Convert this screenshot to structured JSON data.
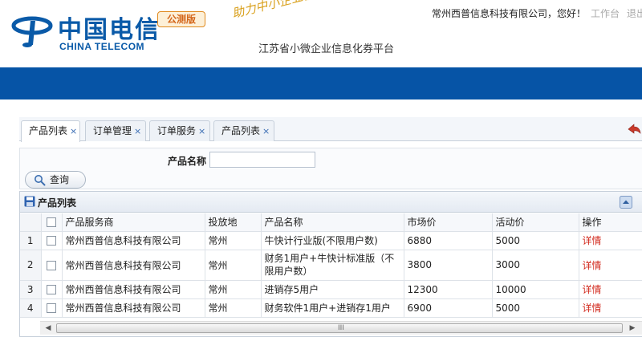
{
  "header": {
    "logo_cn": "中国电信",
    "logo_en": "CHINA TELECOM",
    "badge": "公测版",
    "slogan": "助力中小企业信息化",
    "platform": "江苏省小微企业信息化券平台",
    "welcome": "常州西普信息科技有限公司，您好！",
    "link_workbench": "工作台",
    "link_exit": "退出",
    "brand_color": "#0a5aa8",
    "nav_color": "#0654a6"
  },
  "tabs": [
    {
      "label": "产品列表",
      "close": "×",
      "active": true
    },
    {
      "label": "订单管理",
      "close": "×",
      "active": false
    },
    {
      "label": "订单服务",
      "close": "×",
      "active": false
    },
    {
      "label": "产品列表",
      "close": "×",
      "active": false
    }
  ],
  "search": {
    "label": "产品名称",
    "value": "",
    "placeholder": "",
    "button": "查询"
  },
  "panel": {
    "title": "产品列表"
  },
  "table": {
    "columns": [
      "产品服务商",
      "投放地",
      "产品名称",
      "市场价",
      "活动价",
      "操作"
    ],
    "rows": [
      {
        "idx": "1",
        "vendor": "常州西普信息科技有限公司",
        "place": "常州",
        "name": "牛快计行业版(不限用户数)",
        "market": "6880",
        "promo": "5000",
        "action": "详情"
      },
      {
        "idx": "2",
        "vendor": "常州西普信息科技有限公司",
        "place": "常州",
        "name": "财务1用户+牛快计标准版（不限用户数）",
        "market": "3800",
        "promo": "3000",
        "action": "详情"
      },
      {
        "idx": "3",
        "vendor": "常州西普信息科技有限公司",
        "place": "常州",
        "name": "进销存5用户",
        "market": "12300",
        "promo": "10000",
        "action": "详情"
      },
      {
        "idx": "4",
        "vendor": "常州西普信息科技有限公司",
        "place": "常州",
        "name": "财务软件1用户+进销存1用户",
        "market": "6900",
        "promo": "5000",
        "action": "详情"
      }
    ]
  },
  "scrollbar": {
    "grip": "III"
  }
}
